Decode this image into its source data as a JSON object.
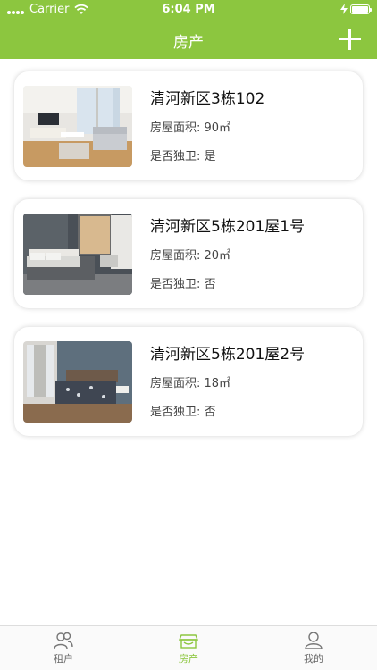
{
  "status_bar": {
    "carrier": "Carrier",
    "time": "6:04 PM"
  },
  "nav": {
    "title": "房产",
    "add_icon": "plus-icon"
  },
  "properties": [
    {
      "title": "清河新区3栋102",
      "area": "房屋面积: 90㎡",
      "private_bath": "是否独卫: 是"
    },
    {
      "title": "清河新区5栋201屋1号",
      "area": "房屋面积: 20㎡",
      "private_bath": "是否独卫: 否"
    },
    {
      "title": "清河新区5栋201屋2号",
      "area": "房屋面积: 18㎡",
      "private_bath": "是否独卫: 否"
    }
  ],
  "tabs": [
    {
      "label": "租户",
      "icon": "people-icon",
      "active": false
    },
    {
      "label": "房产",
      "icon": "house-icon",
      "active": true
    },
    {
      "label": "我的",
      "icon": "person-icon",
      "active": false
    }
  ],
  "colors": {
    "accent": "#8cc63f"
  }
}
